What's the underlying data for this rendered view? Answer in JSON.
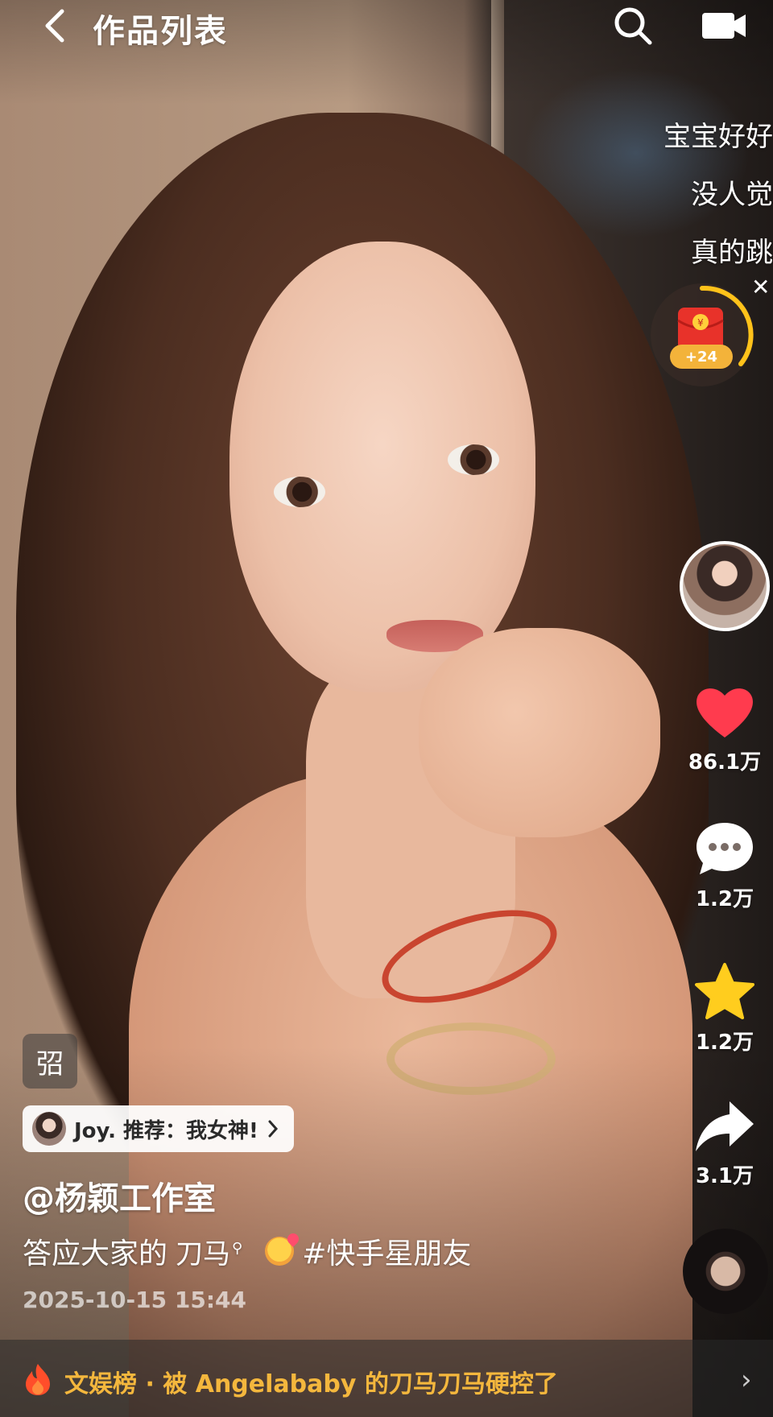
{
  "header": {
    "title": "作品列表"
  },
  "danmaku": [
    "宝宝好好",
    "没人觉",
    "真的跳"
  ],
  "red_packet": {
    "label": "+24"
  },
  "actions": {
    "like_count": "86.1万",
    "comment_count": "1.2万",
    "favorite_count": "1.2万",
    "share_count": "3.1万"
  },
  "mini_badge": "弨",
  "recommendation": {
    "text": "Joy. 推荐：我女神!"
  },
  "post": {
    "author": "@杨颖工作室",
    "caption_prefix": "答应大家的",
    "caption_link": "刀马",
    "hashtag": "#快手星朋友",
    "date": "2025-10-15 15:44"
  },
  "trending": {
    "text": "文娱榜 · 被 Angelababy 的刀马刀马硬控了"
  },
  "colors": {
    "like_red": "#ff3b4e",
    "star_yellow": "#ffcd1e",
    "trend_gold": "#f4b73d",
    "progress_ring": "#ffc21a"
  }
}
